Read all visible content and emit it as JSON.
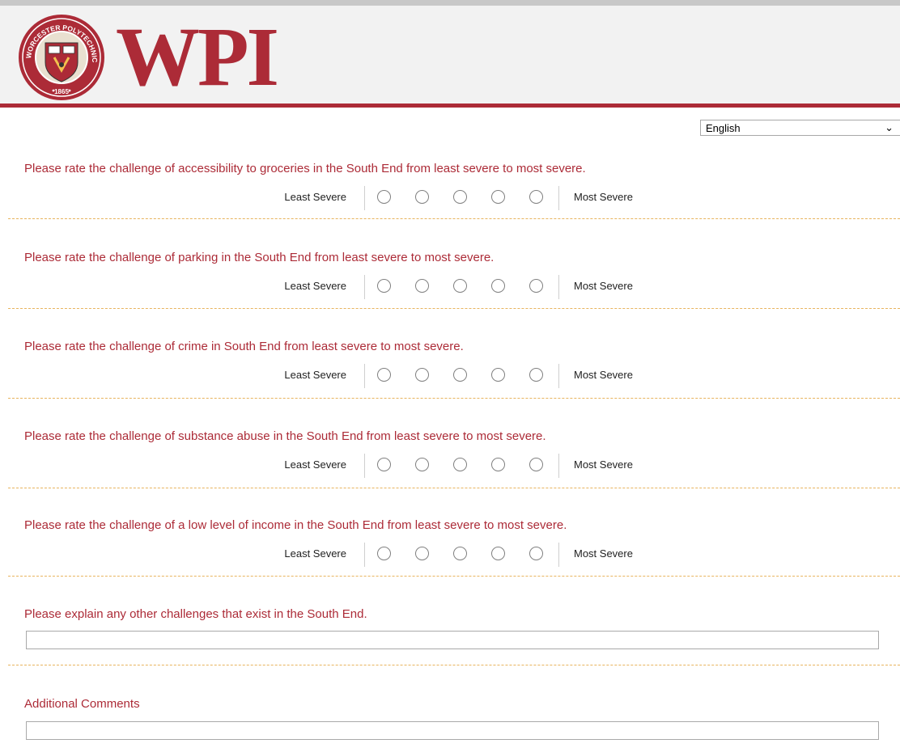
{
  "header": {
    "logo_text": "WPI",
    "seal_text": "WORCESTER POLYTECHNIC INSTITUTE",
    "seal_year": "1865",
    "brand_color": "#ac2b37",
    "seal_icon": "wpi-seal-icon"
  },
  "language_select": {
    "selected": "English",
    "icon": "chevron-down-icon"
  },
  "scale_labels": {
    "least": "Least Severe",
    "most": "Most Severe"
  },
  "questions": [
    {
      "text": "Please rate the challenge of accessibility to groceries in the South End from least severe to most severe."
    },
    {
      "text": "Please rate the challenge of parking in the South End from least severe to most severe."
    },
    {
      "text": "Please rate the challenge of crime in South End from least severe to most severe."
    },
    {
      "text": "Please rate the challenge of substance abuse in the South End from least severe to most severe."
    },
    {
      "text": "Please rate the challenge of a low level of income in the South End from least severe to most severe."
    }
  ],
  "open_questions": [
    {
      "text": "Please explain any other challenges that exist in the South End.",
      "value": ""
    },
    {
      "text": "Additional Comments",
      "value": ""
    }
  ]
}
